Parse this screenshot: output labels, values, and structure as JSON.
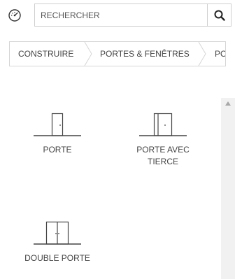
{
  "toolbar": {
    "gauge_icon": "speedometer-icon",
    "search": {
      "placeholder": "RECHERCHER",
      "value": ""
    },
    "search_icon": "magnifier-icon"
  },
  "breadcrumb": {
    "items": [
      {
        "label": "CONSTRUIRE"
      },
      {
        "label": "PORTES & FENÊTRES"
      },
      {
        "label": "PO"
      }
    ]
  },
  "catalog": {
    "items": [
      {
        "label": "PORTE",
        "icon": "door-icon"
      },
      {
        "label": "PORTE AVEC TIERCE",
        "icon": "door-with-side-panel-icon"
      },
      {
        "label": "DOUBLE PORTE",
        "icon": "double-door-icon"
      }
    ]
  },
  "scrollbar": {
    "arrow_icon": "triangle-up-icon"
  },
  "colors": {
    "border": "#cfcfcf",
    "text": "#444444",
    "scroll_track": "#f1f1f1"
  }
}
